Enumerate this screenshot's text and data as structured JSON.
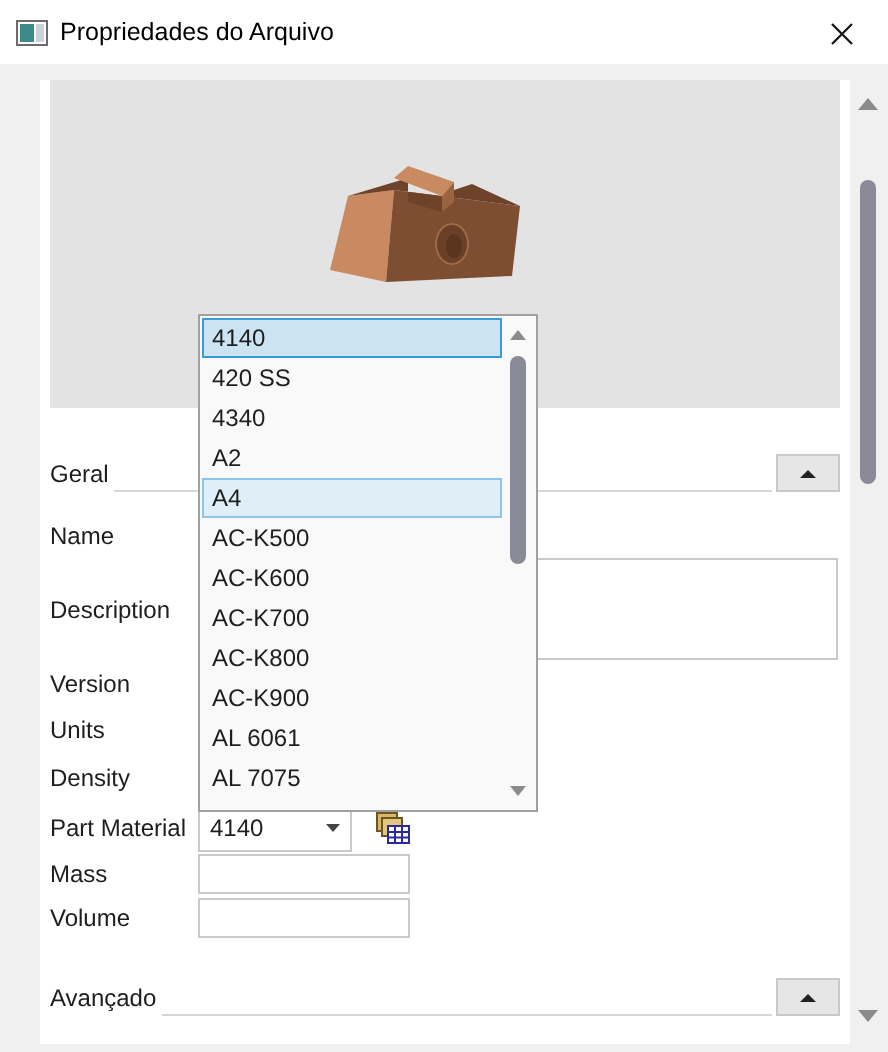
{
  "window": {
    "title": "Propriedades do Arquivo"
  },
  "sections": [
    {
      "title": "Geral",
      "expanded": true
    },
    {
      "title": "Avançado",
      "expanded": true
    }
  ],
  "fields": [
    {
      "label": "Name",
      "kind": "none"
    },
    {
      "label": "Description",
      "kind": "textarea"
    },
    {
      "label": "Version",
      "kind": "none"
    },
    {
      "label": "Units",
      "kind": "none"
    },
    {
      "label": "Density",
      "kind": "none"
    },
    {
      "label": "Part Material",
      "kind": "combo",
      "value": "4140"
    },
    {
      "label": "Mass",
      "kind": "text"
    },
    {
      "label": "Volume",
      "kind": "text"
    }
  ],
  "dropdown": {
    "items": [
      {
        "label": "4140",
        "selected": true,
        "highlighted": false
      },
      {
        "label": "420 SS",
        "selected": false,
        "highlighted": false
      },
      {
        "label": "4340",
        "selected": false,
        "highlighted": false
      },
      {
        "label": "A2",
        "selected": false,
        "highlighted": false
      },
      {
        "label": "A4",
        "selected": false,
        "highlighted": true
      },
      {
        "label": "AC-K500",
        "selected": false,
        "highlighted": false
      },
      {
        "label": "AC-K600",
        "selected": false,
        "highlighted": false
      },
      {
        "label": "AC-K700",
        "selected": false,
        "highlighted": false
      },
      {
        "label": "AC-K800",
        "selected": false,
        "highlighted": false
      },
      {
        "label": "AC-K900",
        "selected": false,
        "highlighted": false
      },
      {
        "label": "AL 6061",
        "selected": false,
        "highlighted": false
      },
      {
        "label": "AL 7075",
        "selected": false,
        "highlighted": false
      }
    ]
  }
}
